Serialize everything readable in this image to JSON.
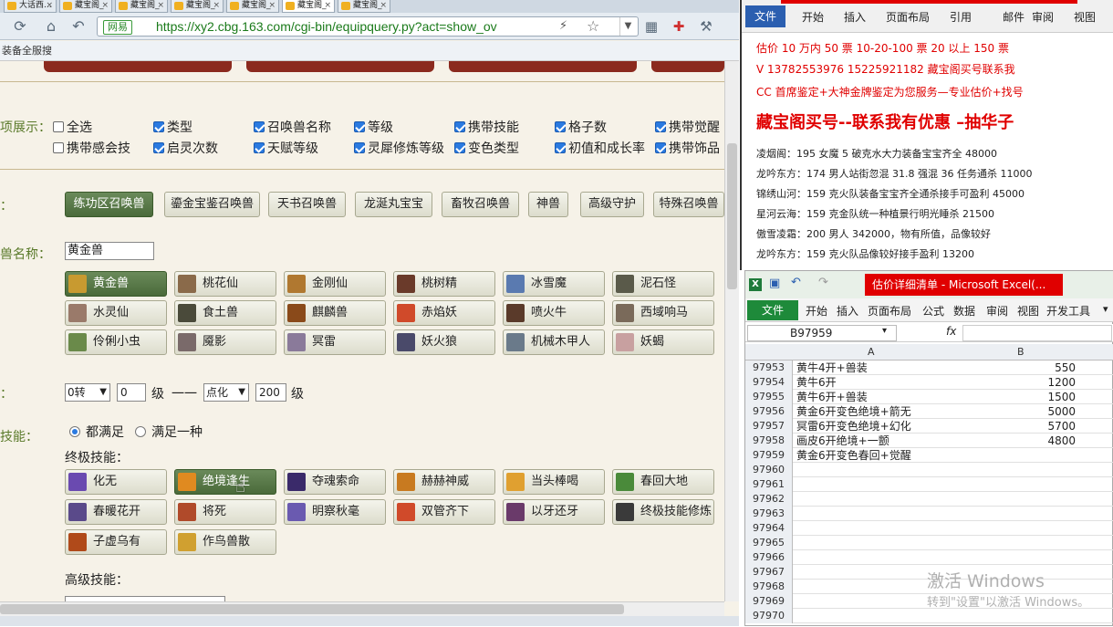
{
  "browser": {
    "tabs": [
      "大话西...",
      "藏宝阁_",
      "藏宝阁_",
      "藏宝阁_",
      "藏宝阁_",
      "藏宝阁_",
      "藏宝阁_"
    ],
    "url": "https://xy2.cbg.163.com/cgi-bin/equipquery.py?act=show_ov",
    "security_label": "网易",
    "bookmark": "装备全服搜"
  },
  "page": {
    "display_label": "项展示：",
    "display_options": [
      {
        "label": "全选",
        "checked": false
      },
      {
        "label": "类型",
        "checked": true
      },
      {
        "label": "召唤兽名称",
        "checked": true
      },
      {
        "label": "等级",
        "checked": true
      },
      {
        "label": "携带技能",
        "checked": true
      },
      {
        "label": "格子数",
        "checked": true
      },
      {
        "label": "携带觉醒",
        "checked": true
      },
      {
        "label": "携带感会技",
        "checked": false
      },
      {
        "label": "启灵次数",
        "checked": true
      },
      {
        "label": "天赋等级",
        "checked": true
      },
      {
        "label": "灵犀修炼等级",
        "checked": true
      },
      {
        "label": "变色类型",
        "checked": true
      },
      {
        "label": "初值和成长率",
        "checked": true
      },
      {
        "label": "携带饰品",
        "checked": true
      }
    ],
    "type_label": "：",
    "types": [
      "练功区召唤兽",
      "鎏金宝鉴召唤兽",
      "天书召唤兽",
      "龙涎丸宝宝",
      "畜牧召唤兽",
      "神兽",
      "高级守护",
      "特殊召唤兽"
    ],
    "name_label": "兽名称：",
    "name_value": "黄金兽",
    "pets": [
      "黄金兽",
      "桃花仙",
      "金刚仙",
      "桃树精",
      "冰雪魔",
      "泥石怪",
      "水灵仙",
      "食土兽",
      "麒麟兽",
      "赤焰妖",
      "喷火牛",
      "西域响马",
      "伶俐小虫",
      "魇影",
      "冥雷",
      "妖火狼",
      "机械木甲人",
      "妖蝎"
    ],
    "level_label": "：",
    "rebirth": "0转",
    "level_min": "0",
    "level_unit1": "级",
    "dash": "一一",
    "tier": "点化",
    "level_max": "200",
    "level_unit2": "级",
    "skill_label": "技能：",
    "radio_all": "都满足",
    "radio_any": "满足一种",
    "ultimate_label": "终极技能：",
    "ultimate_skills": [
      "化无",
      "绝境逢生",
      "夺魂索命",
      "赫赫神威",
      "当头棒喝",
      "春回大地",
      "春暖花开",
      "将死",
      "明察秋毫",
      "双管齐下",
      "以牙还牙",
      "终极技能修炼",
      "子虚乌有",
      "作鸟兽散"
    ],
    "advanced_label": "高级技能："
  },
  "word": {
    "file": "文件",
    "tabs": [
      "开始",
      "插入",
      "页面布局",
      "引用",
      "邮件",
      "审阅",
      "视图"
    ],
    "lines": [
      "估价 10 万内 50 票    10-20-100 票      20 以上 150 票",
      "V 13782553976    15225921182   藏宝阁买号联系我",
      "CC 首席鉴定+大神金牌鉴定为您服务—专业估价+找号",
      "藏宝阁买号--联系我有优惠 –抽华子",
      "凌烟阁：195 女魔 5 破克水大力装备宝宝齐全 48000",
      "龙吟东方：174 男人站街忽混 31.8 强混 36 任务通杀 11000",
      "锦绣山河：159 克火队装备宝宝齐全通杀接手可盈利 45000",
      "星河云海：159 克金队统一种植景行明光睡杀 21500",
      "傲雪凌霜：200 男人 342000，物有所值，品像较好",
      "龙吟东方：159 克火队品像较好接手盈利 13200"
    ]
  },
  "excel": {
    "title": "估价详细清单 - Microsoft Excel(...",
    "file": "文件",
    "tabs": [
      "开始",
      "插入",
      "页面布局",
      "公式",
      "数据",
      "审阅",
      "视图",
      "开发工具"
    ],
    "namebox": "B97959",
    "fx": "fx",
    "col_a": "A",
    "col_b": "B",
    "rows": [
      {
        "n": "97953",
        "a": "黄牛4开+兽装",
        "b": "550"
      },
      {
        "n": "97954",
        "a": "黄牛6开",
        "b": "1200"
      },
      {
        "n": "97955",
        "a": "黄牛6开+兽装",
        "b": "1500"
      },
      {
        "n": "97956",
        "a": "黄金6开变色绝境+箭无",
        "b": "5000"
      },
      {
        "n": "97957",
        "a": "冥雷6开变色绝境+幻化",
        "b": "5700"
      },
      {
        "n": "97958",
        "a": "画皮6开绝境+一颤",
        "b": "4800"
      },
      {
        "n": "97959",
        "a": "黄金6开变色春回+觉醒",
        "b": ""
      },
      {
        "n": "97960",
        "a": "",
        "b": ""
      },
      {
        "n": "97961",
        "a": "",
        "b": ""
      },
      {
        "n": "97962",
        "a": "",
        "b": ""
      },
      {
        "n": "97963",
        "a": "",
        "b": ""
      },
      {
        "n": "97964",
        "a": "",
        "b": ""
      },
      {
        "n": "97965",
        "a": "",
        "b": ""
      },
      {
        "n": "97966",
        "a": "",
        "b": ""
      },
      {
        "n": "97967",
        "a": "",
        "b": ""
      },
      {
        "n": "97968",
        "a": "",
        "b": ""
      },
      {
        "n": "97969",
        "a": "",
        "b": ""
      },
      {
        "n": "97970",
        "a": "",
        "b": ""
      }
    ]
  },
  "watermark": {
    "line1": "激活 Windows",
    "line2": "转到\"设置\"以激活 Windows。"
  }
}
